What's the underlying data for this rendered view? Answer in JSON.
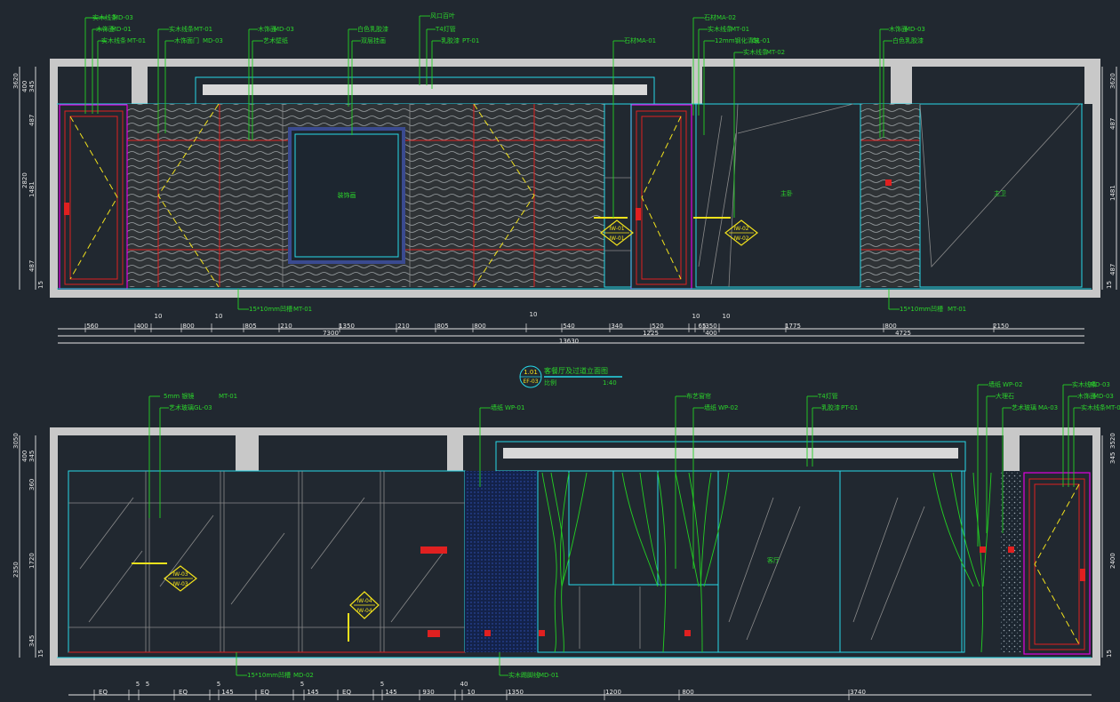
{
  "upper": {
    "callouts": [
      {
        "text": "实木线条",
        "code": "MD-03"
      },
      {
        "text": "木饰面",
        "code": "MD-01"
      },
      {
        "text": "实木线条",
        "code": "MT-01"
      },
      {
        "text": "实木线条",
        "code": "MT-01"
      },
      {
        "text": "木饰面门",
        "code": "MD-03"
      },
      {
        "text": "木饰面",
        "code": "MD-03"
      },
      {
        "text": "艺术壁纸",
        "code": ""
      },
      {
        "text": "白色乳胶漆",
        "code": ""
      },
      {
        "text": "双层挂画",
        "code": ""
      },
      {
        "text": "风口百叶",
        "code": ""
      },
      {
        "text": "T4灯管",
        "code": ""
      },
      {
        "text": "乳胶漆",
        "code": "PT-01"
      },
      {
        "text": "石材",
        "code": "MA-01"
      },
      {
        "text": "石材",
        "code": "MA-02"
      },
      {
        "text": "实木线条",
        "code": "MT-01"
      },
      {
        "text": "12mm钢化清玻",
        "code": "GL-01"
      },
      {
        "text": "实木线条",
        "code": "MT-02"
      },
      {
        "text": "木饰面",
        "code": "MD-03"
      },
      {
        "text": "白色乳胶漆",
        "code": ""
      }
    ],
    "bottom_callouts": [
      {
        "text": "15*10mm凹槽",
        "code": "MT-01"
      },
      {
        "text": "15*10mm凹槽",
        "code": "MT-01"
      }
    ],
    "center_labels": [
      "装饰画",
      "主卧",
      "主卫"
    ],
    "tags": [
      {
        "top": "IW-01",
        "bottom": "IW-01"
      },
      {
        "top": "IW-02",
        "bottom": "IW-02"
      }
    ],
    "left_dims": [
      "3620",
      "400",
      "345",
      "487",
      "2820",
      "1481",
      "487",
      "15"
    ],
    "right_dims": [
      "3620",
      "487",
      "1481",
      "487",
      "15"
    ],
    "dims_row1": [
      "560",
      "400",
      "10",
      "800",
      "10",
      "805",
      "210",
      "1350",
      "210",
      "805",
      "800",
      "10",
      "540",
      "340",
      "520",
      "10",
      "65",
      "350",
      "10",
      "1775",
      "800",
      "2150"
    ],
    "dims_row2": [
      "7300",
      "1225",
      "400",
      "4725"
    ],
    "dims_total": "13630"
  },
  "title_block": {
    "num": "1.01",
    "sheet": "EF-03",
    "title": "客餐厅及过道立面图",
    "scale_label": "比例",
    "scale": "1:40"
  },
  "lower": {
    "callouts": [
      {
        "text": "5mm 银镜",
        "code": "MT-01"
      },
      {
        "text": "艺术玻璃",
        "code": "GL-03"
      },
      {
        "text": "墙纸",
        "code": "WP-01"
      },
      {
        "text": "布艺窗帘",
        "code": ""
      },
      {
        "text": "墙纸",
        "code": "WP-02"
      },
      {
        "text": "T4灯管",
        "code": ""
      },
      {
        "text": "乳胶漆",
        "code": "PT-01"
      },
      {
        "text": "墙纸",
        "code": "WP-02"
      },
      {
        "text": "大理石",
        "code": ""
      },
      {
        "text": "艺术玻璃",
        "code": "MA-03"
      },
      {
        "text": "实木线条",
        "code": "MD-03"
      },
      {
        "text": "木饰面",
        "code": "MD-03"
      },
      {
        "text": "实木线条",
        "code": "MT-01"
      }
    ],
    "bottom_callouts": [
      {
        "text": "15*10mm凹槽",
        "code": "MD-02"
      },
      {
        "text": "实木踢脚线",
        "code": "MD-01"
      }
    ],
    "center_labels": [
      "客厅"
    ],
    "tags": [
      {
        "top": "IW-03",
        "bottom": "IW-03"
      },
      {
        "top": "IW-04",
        "bottom": "IW-04"
      }
    ],
    "left_dims": [
      "3050",
      "400",
      "345",
      "360",
      "2350",
      "1720",
      "345",
      "15"
    ],
    "right_dims": [
      "3520",
      "345",
      "2400",
      "15"
    ],
    "dims_row1": [
      "EQ",
      "5",
      "5",
      "EQ",
      "5",
      "145",
      "EQ",
      "5",
      "145",
      "EQ",
      "5",
      "145",
      "930",
      "40",
      "10",
      "1350",
      "1200",
      "800",
      "3740"
    ]
  },
  "colors": {
    "background": "#212830",
    "line_green": "#23d023",
    "line_cyan": "#27d9e8",
    "line_red": "#e02020",
    "line_magenta": "#e000e0",
    "line_yellow": "#f2e21c",
    "wall_grey": "#c8c8c8"
  }
}
